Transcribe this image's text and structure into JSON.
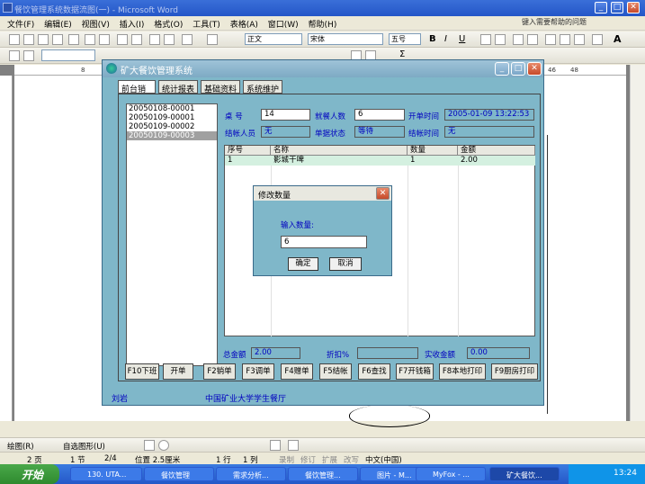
{
  "word": {
    "title": "餐饮管理系统数据流图(一) - Microsoft Word",
    "menu": [
      "文件(F)",
      "编辑(E)",
      "视图(V)",
      "插入(I)",
      "格式(O)",
      "工具(T)",
      "表格(A)",
      "窗口(W)",
      "帮助(H)"
    ],
    "help_placeholder": "键入需要帮助的问题",
    "style_combo": "正文",
    "font_combo": "宋体",
    "size_combo": "五号",
    "ruler_left": "8",
    "ruler_right1": "46",
    "ruler_right2": "48"
  },
  "app": {
    "title": "矿大餐饮管理系统",
    "tabs": [
      "前台销售",
      "统计报表",
      "基础资料",
      "系统维护"
    ],
    "orders": [
      "20050108-00001",
      "20050109-00001",
      "20050109-00002",
      "20050109-00003"
    ],
    "labels": {
      "table": "桌  号",
      "guests": "就餐人数",
      "open_time": "开单时间",
      "cashier": "结帐人员",
      "status": "单据状态",
      "close_time": "结帐时间"
    },
    "values": {
      "table": "14",
      "guests": "6",
      "open_time": "2005-01-09 13:22:53",
      "cashier": "无",
      "status": "等待",
      "close_time": "无"
    },
    "grid": {
      "headers": [
        "序号",
        "名称",
        "数量",
        "金额"
      ],
      "rows": [
        [
          "1",
          "影城干啤",
          "1",
          "2.00"
        ]
      ]
    },
    "summary": {
      "total_label": "总金额",
      "total": "2.00",
      "discount_label": "折扣%",
      "discount": "",
      "paid_label": "实收金额",
      "paid": "0.00"
    },
    "fkeys": [
      "F10下班",
      "开单",
      "F2销单",
      "F3调单",
      "F4赠单",
      "F5结帐",
      "F6查找",
      "F7开钱箱",
      "F8本地打印",
      "F9厨房打印"
    ],
    "footer_left": "刘岩",
    "footer_center": "中国矿业大学学生餐厅"
  },
  "dialog": {
    "title": "修改数量",
    "prompt": "输入数量:",
    "value": "6",
    "ok": "确定",
    "cancel": "取消"
  },
  "drawbar": {
    "draw": "绘图(R)",
    "autoshape": "自选图形(U)"
  },
  "status": {
    "page": "2 页",
    "section": "1 节",
    "pages": "2/4",
    "position": "位置 2.5厘米",
    "line": "1 行",
    "col": "1 列",
    "rec": "录制",
    "trk": "修订",
    "ext": "扩展",
    "ovr": "改写",
    "lang": "中文(中国)"
  },
  "taskbar": {
    "start": "开始",
    "tasks": [
      "130. UTA...",
      "餐饮管理",
      "需求分析...",
      "餐饮管理...",
      "图片 - M...",
      "MyFox - ...",
      "矿大餐饮..."
    ],
    "clock": "13:24"
  },
  "colors": {
    "app_bg": "#7fb7c9",
    "label_blue": "#0000c0",
    "selected_row": "#d4f0e0"
  }
}
